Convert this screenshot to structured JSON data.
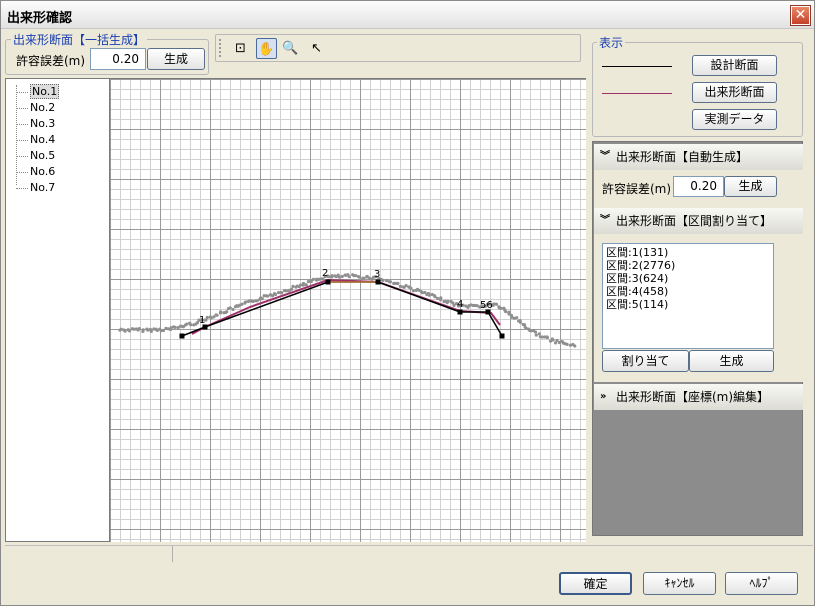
{
  "window": {
    "title": "出来形確認",
    "close_glyph": "✕"
  },
  "batch_group": {
    "legend": "出来形断面【一括生成】",
    "tolerance_label": "許容誤差(m)",
    "tolerance_value": "0.20",
    "generate_label": "生成"
  },
  "toolbar": {
    "tools": [
      {
        "icon": "fit-view-icon",
        "glyph": "⊡"
      },
      {
        "icon": "pan-hand-icon",
        "glyph": "✋"
      },
      {
        "icon": "zoom-icon",
        "glyph": "🔍"
      },
      {
        "icon": "select-arrow-icon",
        "glyph": "↖"
      }
    ]
  },
  "tree": {
    "items": [
      "No.1",
      "No.2",
      "No.3",
      "No.4",
      "No.5",
      "No.6",
      "No.7"
    ],
    "selected_index": 0
  },
  "display_group": {
    "legend": "表示",
    "design_label": "設計断面",
    "asbuilt_label": "出来形断面",
    "measured_label": "実測データ",
    "design_line_color": "#000000",
    "asbuilt_line_color": "#a0306a"
  },
  "auto_section": {
    "title": "出来形断面【自動生成】",
    "tolerance_label": "許容誤差(m)",
    "tolerance_value": "0.20",
    "generate_label": "生成"
  },
  "interval_section": {
    "title": "出来形断面【区間割り当て】",
    "intervals": [
      "区間:1(131)",
      "区間:2(2776)",
      "区間:3(624)",
      "区間:4(458)",
      "区間:5(114)"
    ],
    "assign_label": "割り当て",
    "generate_label": "生成"
  },
  "coord_section": {
    "title": "出来形断面【座標(m)編集】"
  },
  "chart": {
    "point_labels": [
      "1",
      "2",
      "3",
      "4",
      "56"
    ],
    "colors": {
      "design": "#000000",
      "asbuilt": "#a0306a",
      "measured": "#909090",
      "flat": "#c08040"
    }
  },
  "footer": {
    "ok_label": "確定",
    "cancel_label": "ｷｬﾝｾﾙ",
    "help_label": "ﾍﾙﾌﾟ"
  }
}
